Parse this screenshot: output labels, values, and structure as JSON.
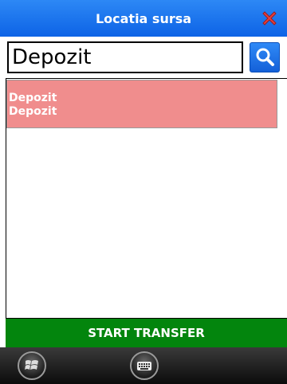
{
  "titlebar": {
    "title": "Locatia sursa",
    "close_icon": "close-x-icon",
    "color": "#1a72ee"
  },
  "search": {
    "value": "Depozit",
    "button_icon": "search-icon"
  },
  "list": {
    "items": [
      {
        "line1": "Depozit",
        "line2": "Depozit",
        "highlight_color": "#f08d8d"
      }
    ]
  },
  "actions": {
    "start_transfer_label": "START TRANSFER",
    "color": "#03850d"
  },
  "taskbar": {
    "start_icon": "windows-start-icon",
    "keyboard_icon": "keyboard-icon"
  }
}
